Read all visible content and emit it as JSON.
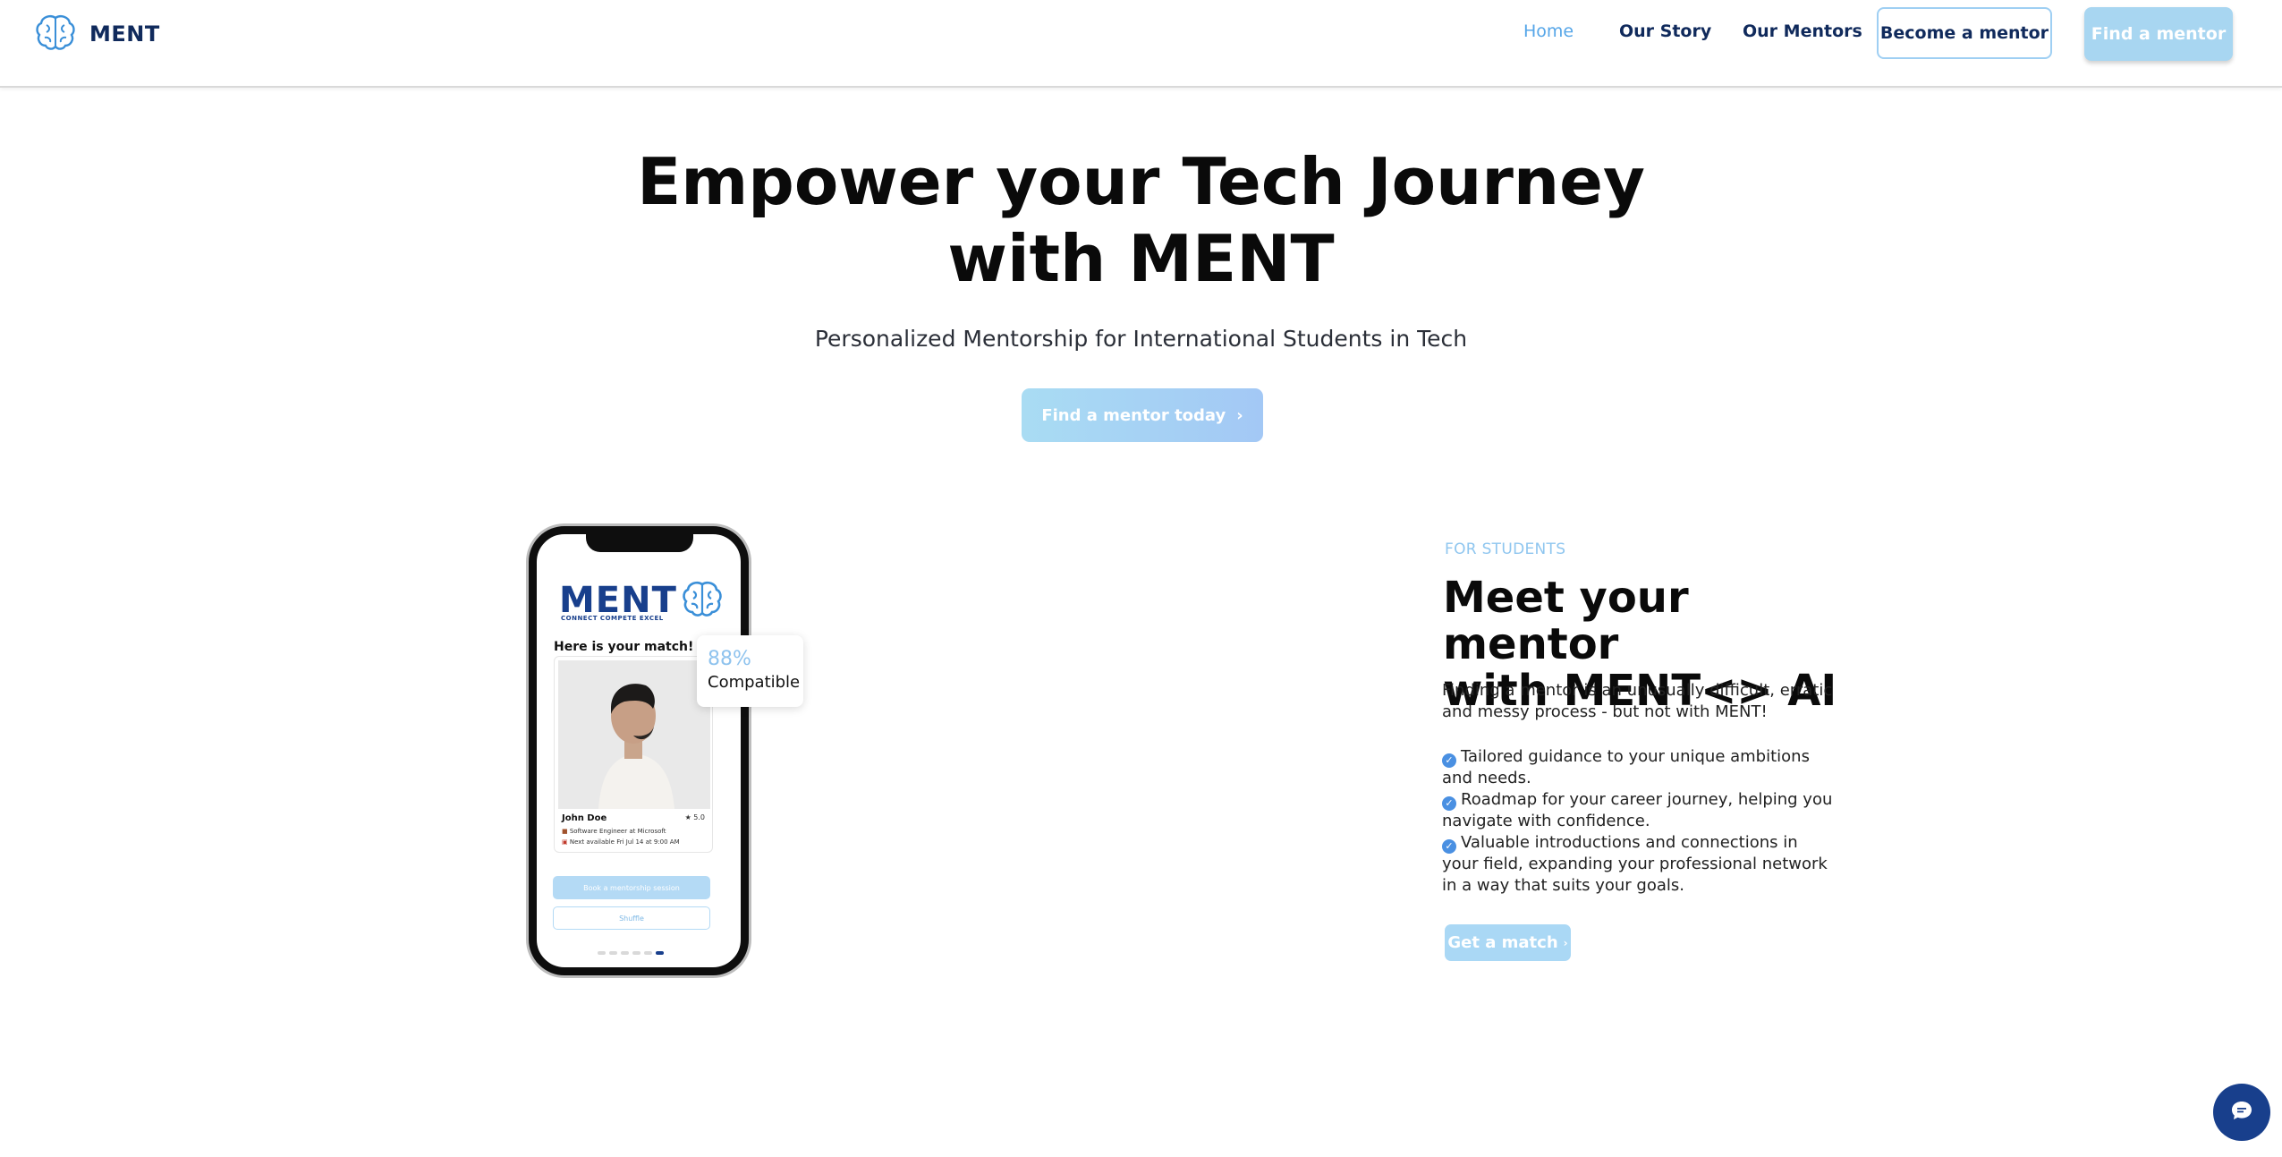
{
  "header": {
    "brand": "MENT",
    "nav": [
      {
        "label": "Home",
        "active": true
      },
      {
        "label": "Our Story",
        "active": false
      },
      {
        "label": "Our Mentors",
        "active": false
      }
    ],
    "become_mentor_label": "Become a mentor",
    "find_mentor_label": "Find a mentor"
  },
  "hero": {
    "title_line1": "Empower your Tech Journey",
    "title_line2": "with MENT",
    "subtitle": "Personalized Mentorship for International Students in Tech",
    "cta_label": "Find a mentor today",
    "cta_icon": "chevron-right-icon"
  },
  "phone": {
    "logo_word": "MENT",
    "logo_tagline": "CONNECT COMPETE EXCEL",
    "match_title": "Here is your match!",
    "mentor": {
      "name": "John Doe",
      "rating": "★ 5.0",
      "role": "Software Engineer at Microsoft",
      "availability": "Next available Fri Jul 14 at 9:00 AM"
    },
    "book_label": "Book a mentorship session",
    "shuffle_label": "Shuffle",
    "carousel_pages": 6,
    "carousel_active": 6
  },
  "compat": {
    "percent": "88%",
    "label": "Compatible"
  },
  "students": {
    "eyebrow": "FOR STUDENTS",
    "title_line1": "Meet your mentor",
    "title_line2": "with MENT<> AI",
    "description": "Finding a mentor is an unusually difficult, erratic and messy process - but not with MENT!",
    "benefits": [
      "Tailored guidance to your unique ambitions and needs.",
      "Roadmap for your career journey, helping you navigate with confidence.",
      "Valuable introductions and connections in your field, expanding your professional network in a way that suits your goals."
    ],
    "cta_label": "Get a match",
    "cta_icon": "chevron-right-icon"
  },
  "chat": {
    "icon": "chat-bubble-icon"
  },
  "colors": {
    "brand_navy": "#183f8c",
    "accent_blue": "#56a6e8",
    "button_light_blue": "#a8d6f1"
  }
}
